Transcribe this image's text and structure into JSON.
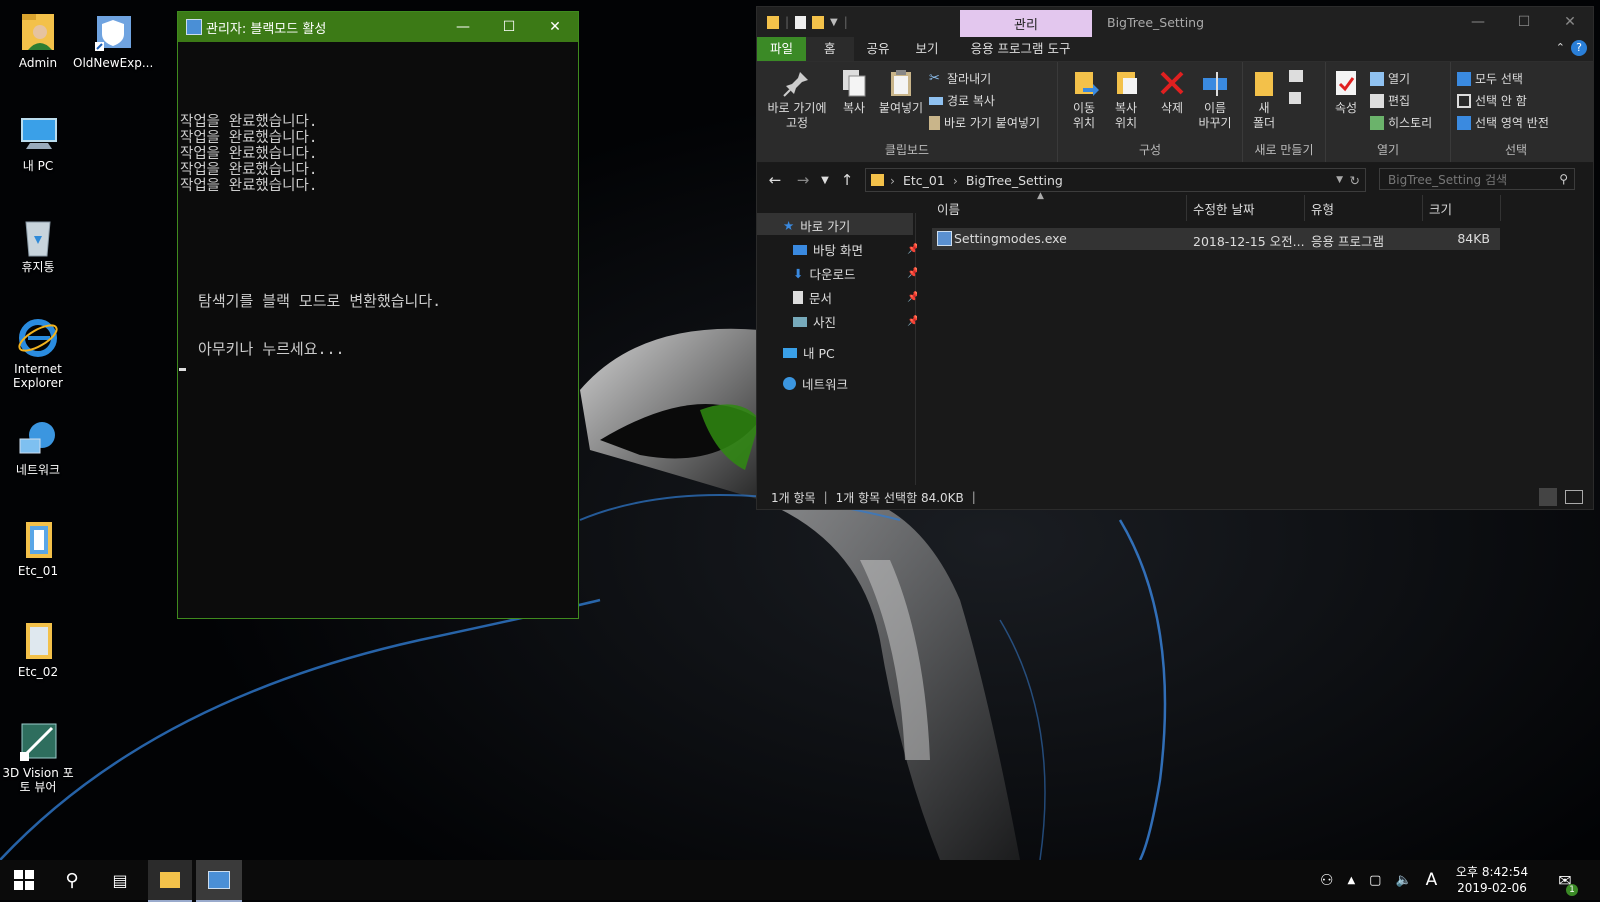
{
  "desktop": {
    "icons": [
      {
        "label": "Admin",
        "icon": "user-folder-icon"
      },
      {
        "label": "OldNewExp...",
        "icon": "shield-shortcut-icon"
      },
      {
        "label": "내 PC",
        "icon": "computer-icon"
      },
      {
        "label": "휴지통",
        "icon": "recycle-bin-icon"
      },
      {
        "label": "Internet Explorer",
        "icon": "internet-explorer-icon"
      },
      {
        "label": "네트워크",
        "icon": "network-icon"
      },
      {
        "label": "Etc_01",
        "icon": "folder-icon"
      },
      {
        "label": "Etc_02",
        "icon": "folder-icon"
      },
      {
        "label": "3D Vision 포토 뷰어",
        "icon": "3d-vision-photo-viewer-icon"
      }
    ]
  },
  "console": {
    "title": "관리자:  블랙모드 활성",
    "lines": [
      "작업을 완료했습니다.",
      "작업을 완료했습니다.",
      "작업을 완료했습니다.",
      "작업을 완료했습니다.",
      "작업을 완료했습니다."
    ],
    "message1": "  탐색기를 블랙 모드로 변환했습니다.",
    "message2": "  아무키나 누르세요...",
    "accent": "#3c7a16"
  },
  "explorer": {
    "window_title": "BigTree_Setting",
    "context_tab": "관리",
    "ribbon_tabs": [
      "파일",
      "홈",
      "공유",
      "보기",
      "응용 프로그램 도구"
    ],
    "ribbon": {
      "pin": "바로 가기에\n고정",
      "copy": "복사",
      "paste": "붙여넣기",
      "cut": "잘라내기",
      "copy_path": "경로 복사",
      "paste_shortcut": "바로 가기 붙여넣기",
      "clipboard_group": "클립보드",
      "move_to": "이동\n위치",
      "copy_to": "복사\n위치",
      "delete": "삭제",
      "rename": "이름\n바꾸기",
      "organize_group": "구성",
      "new_folder": "새\n폴더",
      "new_group": "새로 만들기",
      "properties": "속성",
      "open": "열기",
      "edit": "편집",
      "history": "히스토리",
      "open_group": "열기",
      "select_all": "모두 선택",
      "select_none": "선택 안 함",
      "invert_selection": "선택 영역 반전",
      "select_group": "선택"
    },
    "address": {
      "crumbs": [
        "Etc_01",
        "BigTree_Setting"
      ]
    },
    "search_placeholder": "BigTree_Setting 검색",
    "nav": {
      "quick_access": "바로 가기",
      "desktop": "바탕 화면",
      "downloads": "다운로드",
      "documents": "문서",
      "pictures": "사진",
      "this_pc": "내 PC",
      "network": "네트워크"
    },
    "columns": {
      "name": "이름",
      "date": "수정한 날짜",
      "type": "유형",
      "size": "크기"
    },
    "files": [
      {
        "name": "Settingmodes.exe",
        "date": "2018-12-15 오전...",
        "type": "응용 프로그램",
        "size": "84KB"
      }
    ],
    "status": {
      "count": "1개 항목",
      "selected": "1개 항목 선택함 84.0KB"
    }
  },
  "taskbar": {
    "time": "오후 8:42:54",
    "date": "2019-02-06",
    "ime": "A",
    "notification_count": "1"
  }
}
